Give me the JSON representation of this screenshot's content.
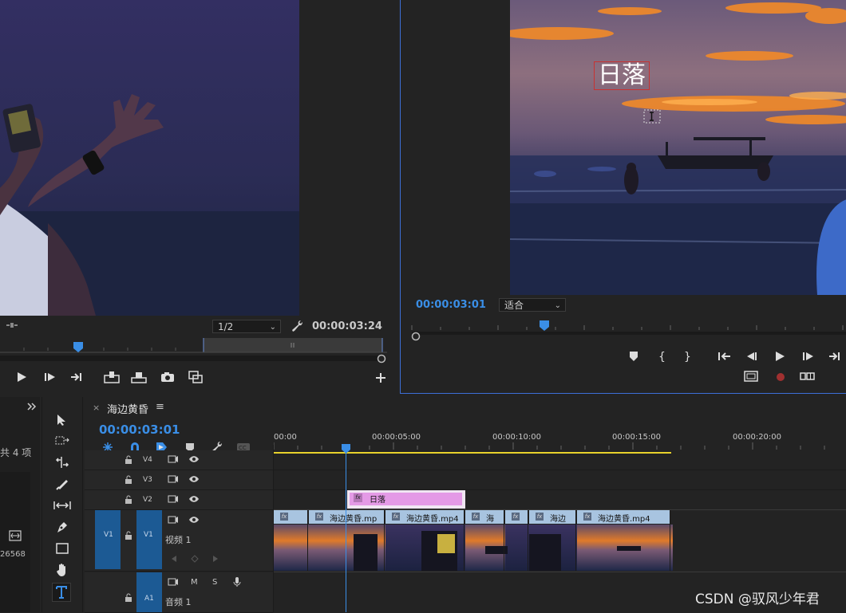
{
  "source_monitor": {
    "resolution": "1/2",
    "timecode": "00:00:03:24"
  },
  "program_monitor": {
    "timecode": "00:00:03:01",
    "zoom": "适合",
    "title_overlay_text": "日落"
  },
  "project_panel": {
    "item_count": "共 4 项",
    "value_label": "26568"
  },
  "timeline": {
    "tab_close": "×",
    "sequence_name": "海边黄昏",
    "menu_glyph": "≡",
    "timecode": "00:00:03:01",
    "ruler": [
      "00:00",
      "00:00:05:00",
      "00:00:10:00",
      "00:00:15:00",
      "00:00:20:00"
    ],
    "tracks": {
      "v4": "V4",
      "v3": "V3",
      "v2": "V2",
      "v1_source": "V1",
      "v1": "V1",
      "v1_name": "视频 1",
      "a1": "A1",
      "a1_name": "音频 1",
      "m": "M",
      "s": "S"
    },
    "title_clip": {
      "fx": "fx",
      "name": "日落"
    },
    "video_clips": [
      {
        "fx": "fx",
        "name": ""
      },
      {
        "fx": "fx",
        "name": "海边黄昏.mp"
      },
      {
        "fx": "fx",
        "name": "海边黄昏.mp4"
      },
      {
        "fx": "fx",
        "name": "海"
      },
      {
        "fx": "fx",
        "name": ""
      },
      {
        "fx": "fx",
        "name": "海边"
      },
      {
        "fx": "fx",
        "name": "海边黄昏.mp4"
      }
    ]
  },
  "watermark": "CSDN @驭风少年君"
}
